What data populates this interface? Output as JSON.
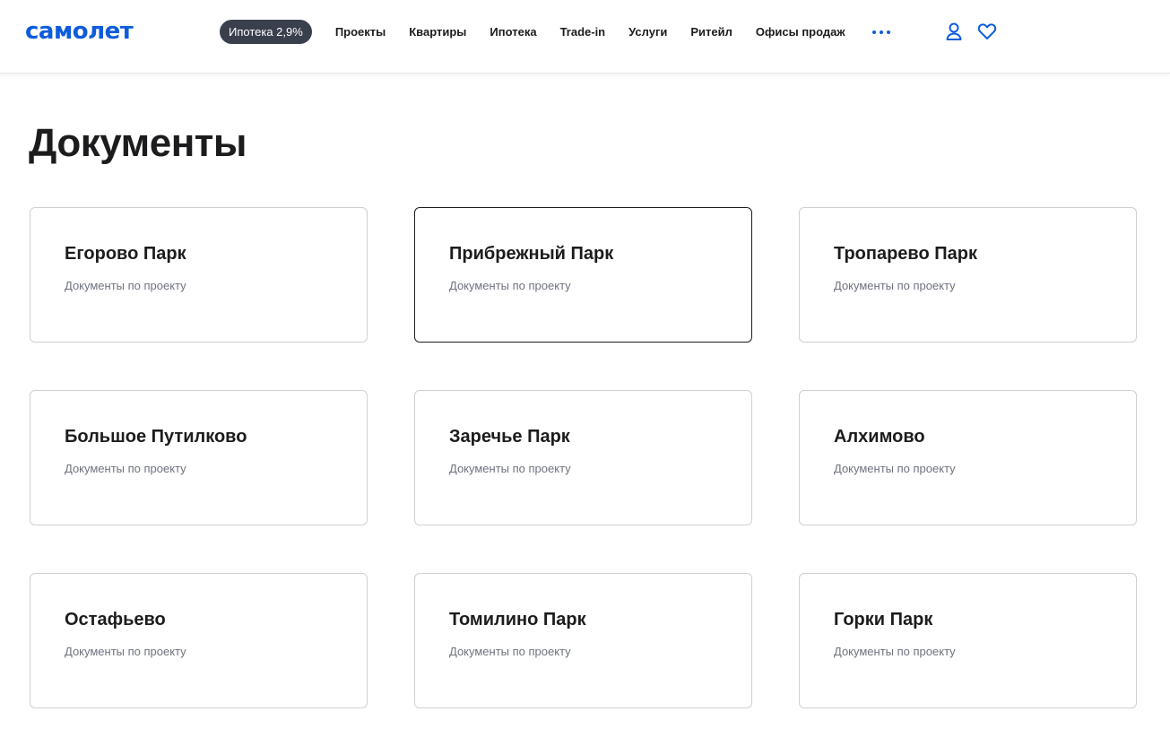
{
  "header": {
    "logo": "самолет",
    "promo_pill": "Ипотека 2,9%",
    "nav_items": [
      "Проекты",
      "Квартиры",
      "Ипотека",
      "Trade-in",
      "Услуги",
      "Ритейл",
      "Офисы продаж"
    ],
    "more_icon": "more-dots-icon",
    "user_icon": "user-icon",
    "favorites_icon": "heart-icon"
  },
  "page": {
    "title": "Документы"
  },
  "cards": [
    {
      "title": "Егорово Парк",
      "subtitle": "Документы по проекту"
    },
    {
      "title": "Прибрежный Парк",
      "subtitle": "Документы по проекту"
    },
    {
      "title": "Тропарево Парк",
      "subtitle": "Документы по проекту"
    },
    {
      "title": "Большое Путилково",
      "subtitle": "Документы по проекту"
    },
    {
      "title": "Заречье Парк",
      "subtitle": "Документы по проекту"
    },
    {
      "title": "Алхимово",
      "subtitle": "Документы по проекту"
    },
    {
      "title": "Остафьево",
      "subtitle": "Документы по проекту"
    },
    {
      "title": "Томилино Парк",
      "subtitle": "Документы по проекту"
    },
    {
      "title": "Горки Парк",
      "subtitle": "Документы по проекту"
    }
  ],
  "colors": {
    "brand": "#0d5cdc",
    "pill_bg": "#3a3f4d",
    "text": "#1c1c1e",
    "muted": "#6f7280",
    "card_border": "#cfd0d4"
  }
}
